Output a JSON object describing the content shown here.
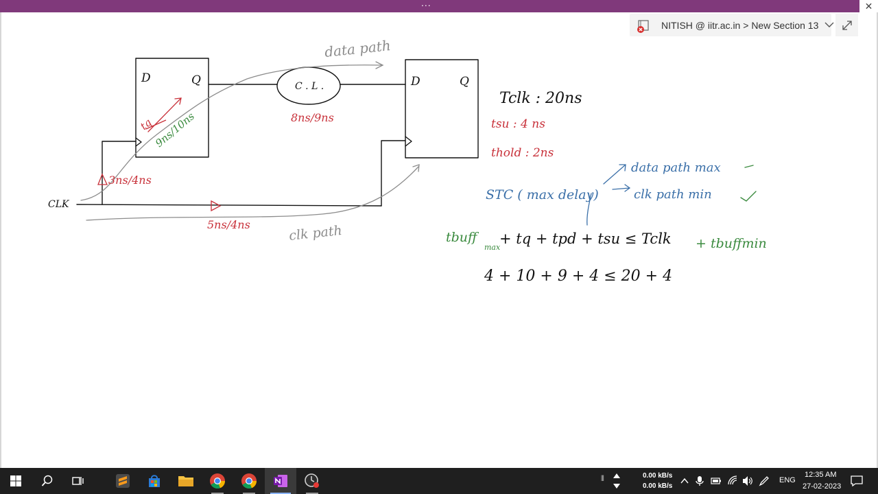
{
  "window": {
    "menu_dots": "...",
    "close_glyph": "✕",
    "navigation": {
      "user": "NITISH @ iitr.ac.in",
      "separator": ">",
      "section": "New Section 13"
    }
  },
  "notes": {
    "flipflop1": {
      "d": "D",
      "q": "Q",
      "tq_label": "tq",
      "delay_label": "9ns/10ns"
    },
    "flipflop2": {
      "d": "D",
      "q": "Q"
    },
    "combinational_logic": {
      "label": "C . L .",
      "delay": "8ns/9ns"
    },
    "data_path_label": "data path",
    "clk_label": "CLK",
    "clk_path_label": "clk path",
    "buffer1_delay": "3ns/4ns",
    "buffer2_delay": "5ns/4ns",
    "tclk": "Tclk : 20ns",
    "tsu": "tsu : 4 ns",
    "thold": "thold : 2ns",
    "stc": "STC ( max delay)",
    "stc_data": "data path max",
    "stc_clk": "clk path min",
    "eq_part1": "tbuff",
    "eq_sub": "max",
    "eq_part2": "+ tq + tpd + tsu ≤ Tclk",
    "eq_part3": "+ tbuffmin",
    "eq_numeric": "4 + 10 + 9 + 4  ≤  20 + 4"
  },
  "taskbar": {
    "apps": [
      "start-icon",
      "search-icon",
      "task-view-icon",
      "sublime-icon",
      "store-icon",
      "file-explorer-icon",
      "chrome-icon",
      "chrome-icon",
      "onenote-icon",
      "screen-recorder-icon"
    ],
    "upload_speed": "0.00 kB/s",
    "download_speed": "0.00 kB/s",
    "language": "ENG",
    "time": "12:35 AM",
    "date": "27-02-2023",
    "colors": {
      "taskbar": "#1f1f1f",
      "onenote": "#7719aa",
      "titlebar": "#80397b"
    }
  }
}
